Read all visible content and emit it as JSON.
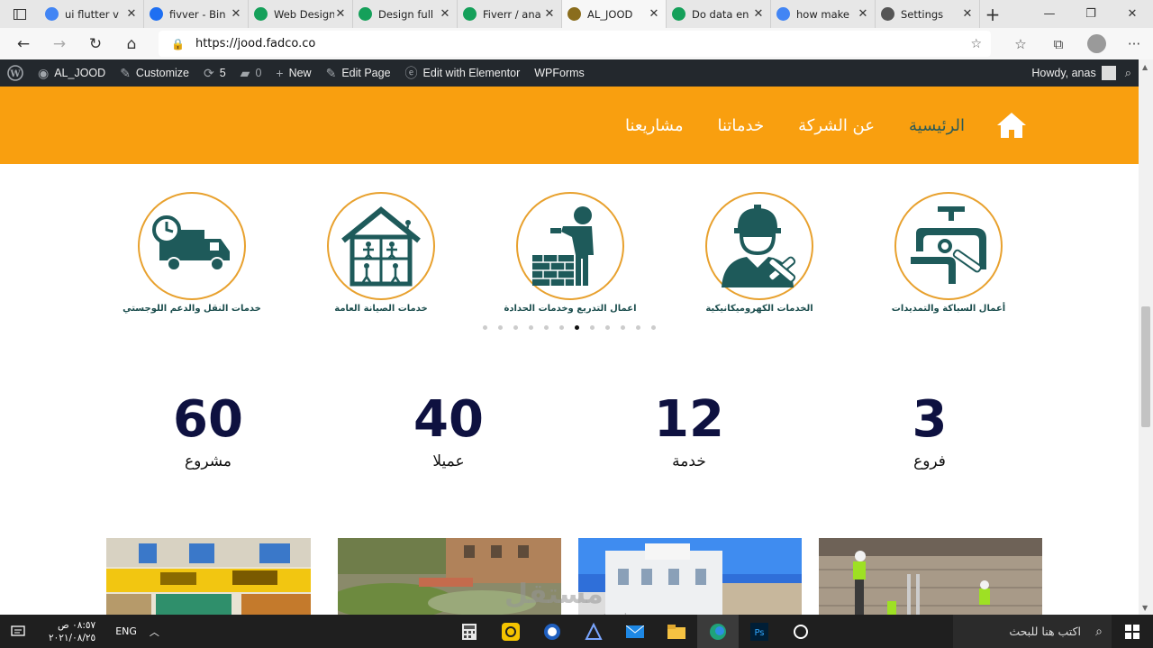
{
  "browser": {
    "tabs": [
      {
        "label": "ui flutter v",
        "icon": "google-icon",
        "color": "#4285f4"
      },
      {
        "label": "fivver - Bin",
        "icon": "bing-icon",
        "color": "#1e6ff2"
      },
      {
        "label": "Web Design",
        "icon": "fadco-icon",
        "color": "#15a05a"
      },
      {
        "label": "Design full",
        "icon": "fadco-icon",
        "color": "#15a05a"
      },
      {
        "label": "Fiverr / ana",
        "icon": "fadco-icon",
        "color": "#15a05a"
      },
      {
        "label": "AL_JOOD",
        "icon": "site-icon",
        "color": "#8a6d1d",
        "active": true
      },
      {
        "label": "Do data en",
        "icon": "fadco-icon",
        "color": "#15a05a"
      },
      {
        "label": "how make",
        "icon": "google-icon",
        "color": "#4285f4"
      },
      {
        "label": "Settings",
        "icon": "gear-icon",
        "color": "#555555"
      }
    ],
    "url": "https://jood.fadco.co"
  },
  "wp_admin_bar": {
    "site_name": "AL_JOOD",
    "customize": "Customize",
    "updates_count": "5",
    "comments_count": "0",
    "new_label": "New",
    "edit_page": "Edit Page",
    "edit_elementor": "Edit with Elementor",
    "wpforms": "WPForms",
    "howdy": "Howdy, anas"
  },
  "site": {
    "brand_color": "#f99f0f",
    "nav": {
      "home": "الرئيسية",
      "about": "عن الشركة",
      "services": "خدماتنا",
      "projects": "مشاريعنا"
    },
    "services": [
      {
        "label": "خدمات النقل والدعم اللوجستي",
        "icon": "truck-clock-icon"
      },
      {
        "label": "خدمات الصيانة العامة",
        "icon": "house-workers-icon"
      },
      {
        "label": "اعمال التدريع وخدمات الحدادة",
        "icon": "bricklayer-icon"
      },
      {
        "label": "الخدمات الكهروميكانيكية",
        "icon": "engineer-tools-icon"
      },
      {
        "label": "أعمال السباكة والتمديدات",
        "icon": "pipes-wrench-icon"
      }
    ],
    "slider_dots": 12,
    "slider_active_dot": 6,
    "stats": [
      {
        "number": "60",
        "caption": "مشروع"
      },
      {
        "number": "40",
        "caption": "عميلا"
      },
      {
        "number": "12",
        "caption": "خدمة"
      },
      {
        "number": "3",
        "caption": "فروع"
      }
    ]
  },
  "taskbar": {
    "time": "٠٨:٥٧ ص",
    "date": "٢٠٢١/٠٨/٢٥",
    "language": "ENG",
    "search_placeholder": "اكتب هنا للبحث"
  }
}
